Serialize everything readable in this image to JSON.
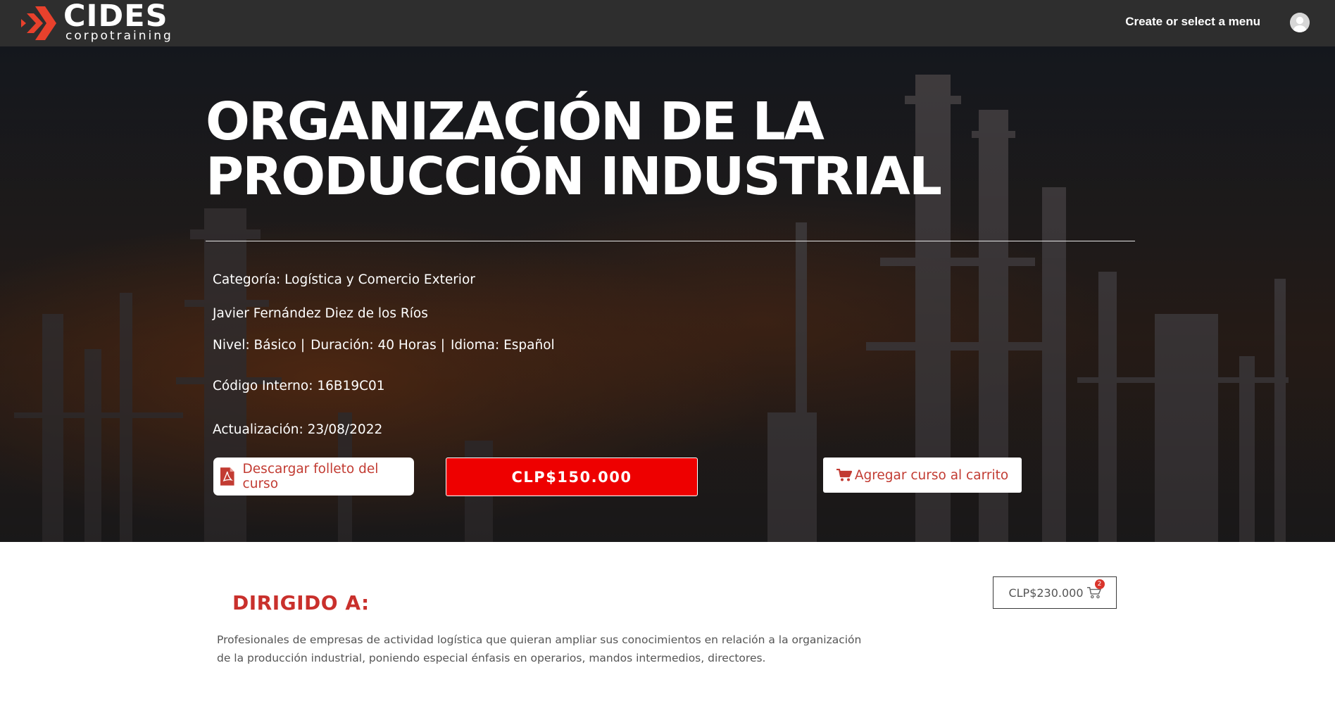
{
  "header": {
    "logo_text": "CIDES",
    "logo_subtext": "corpotraining",
    "menu_label": "Create or select a menu"
  },
  "course": {
    "title": "ORGANIZACIÓN DE LA PRODUCCIÓN INDUSTRIAL",
    "category": "Categoría: Logística y Comercio Exterior",
    "instructor": "Javier Fernández Diez de los Ríos",
    "level": "Nivel: Básico",
    "duration": "Duración: 40 Horas",
    "language": "Idioma: Español",
    "separator": "|",
    "internal_code": "Código Interno: 16B19C01",
    "updated": "Actualización: 23/08/2022"
  },
  "actions": {
    "brochure_label": "Descargar folleto del curso",
    "price_label": "CLP$150.000",
    "add_to_cart_label": "Agregar curso al carrito"
  },
  "audience": {
    "heading": "DIRIGIDO A:",
    "body": "Profesionales de empresas de actividad logística que quieran ampliar sus conocimientos en relación a la organización de la producción industrial, poniendo especial énfasis en operarios, mandos intermedios, directores."
  },
  "mini_cart": {
    "total": "CLP$230.000",
    "count": "2"
  },
  "colors": {
    "topbar": "#2e2e2e",
    "accent_red": "#ee0000",
    "brand_red": "#e8412c",
    "link_red": "#c23b32"
  },
  "icons": [
    "logo-chevrons-icon",
    "user-avatar-icon",
    "pdf-icon",
    "shopping-cart-icon"
  ]
}
